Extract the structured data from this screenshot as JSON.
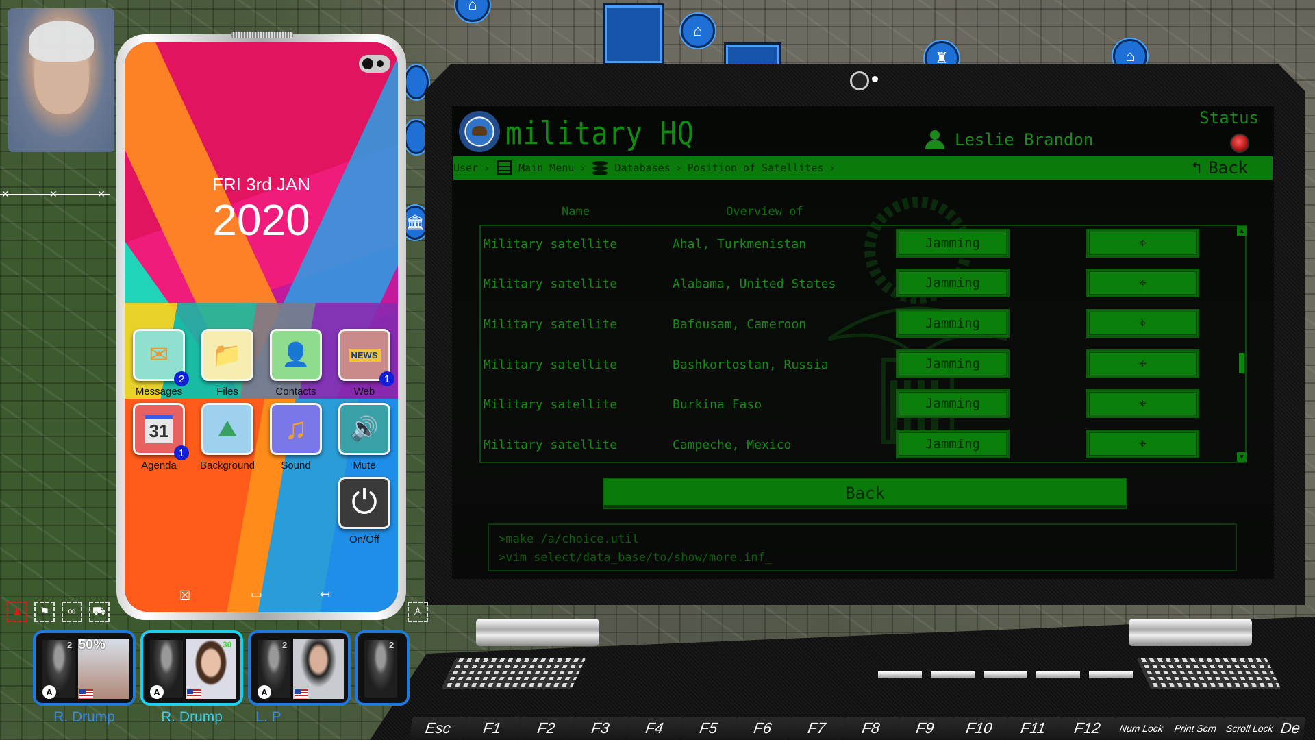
{
  "map": {
    "markers": [
      "house-marker",
      "house-marker",
      "house-marker",
      "tower-marker",
      "bank-marker"
    ]
  },
  "laptop": {
    "app_title": "military HQ",
    "user_name": "Leslie Brandon",
    "status_label": "Status",
    "status_color": "#d42020",
    "breadcrumb": {
      "user": "User",
      "main_menu": "Main Menu",
      "databases": "Databases",
      "position": "Position of Satellites",
      "separator": "›"
    },
    "back_top_label": "Back",
    "back_icon": "↰",
    "columns": {
      "name": "Name",
      "overview": "Overview of"
    },
    "rows": [
      {
        "name": "Military satellite",
        "location": "Ahal, Turkmenistan",
        "action": "Jamming",
        "target_icon": "⌖"
      },
      {
        "name": "Military satellite",
        "location": "Alabama, United States",
        "action": "Jamming",
        "target_icon": "⌖"
      },
      {
        "name": "Military satellite",
        "location": "Bafousam, Cameroon",
        "action": "Jamming",
        "target_icon": "⌖"
      },
      {
        "name": "Military satellite",
        "location": "Bashkortostan, Russia",
        "action": "Jamming",
        "target_icon": "⌖"
      },
      {
        "name": "Military satellite",
        "location": "Burkina Faso",
        "action": "Jamming",
        "target_icon": "⌖"
      },
      {
        "name": "Military satellite",
        "location": "Campeche, Mexico",
        "action": "Jamming",
        "target_icon": "⌖"
      }
    ],
    "scroll": {
      "up": "▲",
      "down": "▼"
    },
    "back_main_label": "Back",
    "console": [
      ">make /a/choice.util",
      ">vim select/data_base/to/show/more.inf_"
    ],
    "accent_color": "#0a7a0a"
  },
  "phone": {
    "date_line": "FRI 3rd JAN",
    "year": "2020",
    "apps": [
      {
        "label": "Messages",
        "icon": "✉",
        "badge": "2",
        "bg": "#8fe0cf"
      },
      {
        "label": "Files",
        "icon": "📁",
        "badge": null,
        "bg": "#f6eeb0"
      },
      {
        "label": "Contacts",
        "icon": "👤",
        "badge": null,
        "bg": "#8fdc8f"
      },
      {
        "label": "Web",
        "icon": "NEWS",
        "badge": "1",
        "bg": "#c98a8a"
      },
      {
        "label": "Agenda",
        "icon": "31",
        "badge": "1",
        "bg": "#e86060"
      },
      {
        "label": "Background",
        "icon": "⛰",
        "badge": null,
        "bg": "#9ed0f0"
      },
      {
        "label": "Sound",
        "icon": "♫",
        "badge": null,
        "bg": "#7a78e8"
      },
      {
        "label": "Mute",
        "icon": "🔊",
        "badge": null,
        "bg": "#3aa0a8"
      },
      {
        "label": "On/Off",
        "icon": "⏻",
        "badge": null,
        "bg": "#3a3a3a"
      }
    ],
    "nav": {
      "close": "☒",
      "home": "▭",
      "back": "↤"
    }
  },
  "toolbar": {
    "tools": [
      {
        "name": "agent-filter",
        "icon": "♟",
        "active": true
      },
      {
        "name": "flag-filter",
        "icon": "⚑",
        "active": false
      },
      {
        "name": "mask-filter",
        "icon": "∞",
        "active": false
      },
      {
        "name": "tank-filter",
        "icon": "⛟",
        "active": false
      }
    ]
  },
  "agents": [
    {
      "name": "R. Drump",
      "level": "2",
      "stat": "50%",
      "rank": "A"
    },
    {
      "name": "R. Drump",
      "level": "",
      "stat": "30",
      "rank": "A"
    },
    {
      "name": "L. P",
      "level": "2",
      "stat": "",
      "rank": "A"
    },
    {
      "name": "",
      "level": "2",
      "stat": "",
      "rank": ""
    }
  ],
  "keyboard": {
    "keys": [
      "Esc",
      "F1",
      "F2",
      "F3",
      "F4",
      "F5",
      "F6",
      "F7",
      "F8",
      "F9",
      "F10",
      "F11",
      "F12",
      "Num Lock",
      "Print Scrn",
      "Scroll Lock",
      "De"
    ]
  }
}
